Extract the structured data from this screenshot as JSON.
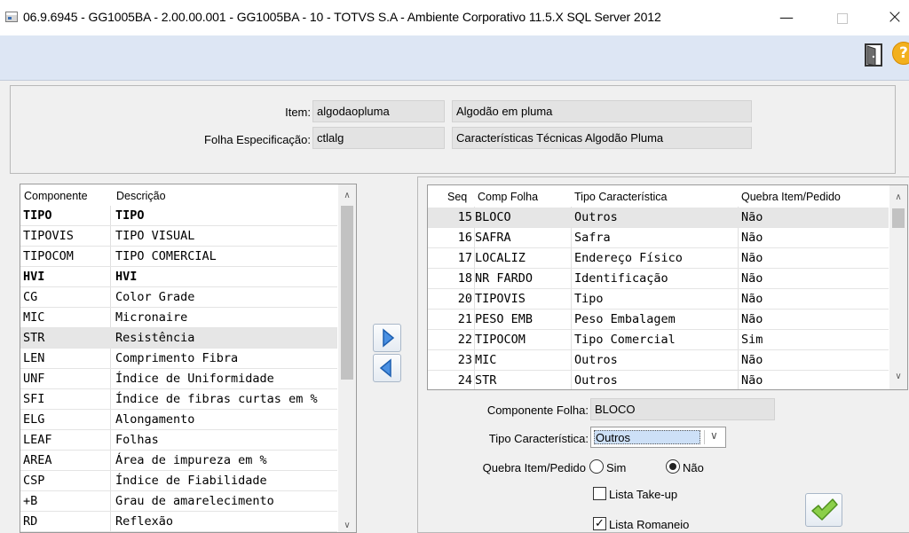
{
  "window": {
    "title": "06.9.6945 - GG1005BA - 2.00.00.001 - GG1005BA - 10 - TOTVS S.A - Ambiente Corporativo 11.5.X SQL Server 2012",
    "minimize": "—",
    "close": "×"
  },
  "header": {
    "item_label": "Item:",
    "item_code": "algodaopluma",
    "item_desc": "Algodão em pluma",
    "folha_label": "Folha Especificação:",
    "folha_code": "ctlalg",
    "folha_desc": "Características Técnicas Algodão Pluma"
  },
  "left_grid": {
    "col_componente": "Componente",
    "col_descricao": "Descrição",
    "rows": [
      {
        "c": "TIPO",
        "d": "TIPO"
      },
      {
        "c": "TIPOVIS",
        "d": "TIPO VISUAL"
      },
      {
        "c": "TIPOCOM",
        "d": "TIPO COMERCIAL"
      },
      {
        "c": "HVI",
        "d": "HVI"
      },
      {
        "c": "CG",
        "d": "Color Grade"
      },
      {
        "c": "MIC",
        "d": "Micronaire"
      },
      {
        "c": "STR",
        "d": "Resistência"
      },
      {
        "c": "LEN",
        "d": "Comprimento Fibra"
      },
      {
        "c": "UNF",
        "d": "Índice de Uniformidade"
      },
      {
        "c": "SFI",
        "d": "Índice de fibras curtas em %"
      },
      {
        "c": "ELG",
        "d": "Alongamento"
      },
      {
        "c": "LEAF",
        "d": "Folhas"
      },
      {
        "c": "AREA",
        "d": "Área de impureza em %"
      },
      {
        "c": "CSP",
        "d": "Índice de Fiabilidade"
      },
      {
        "c": "+B",
        "d": "Grau de amarelecimento"
      },
      {
        "c": "RD",
        "d": "Reflexão"
      }
    ]
  },
  "right_grid": {
    "col_seq": "Seq",
    "col_comp": "Comp Folha",
    "col_tipo": "Tipo Característica",
    "col_quebra": "Quebra Item/Pedido",
    "rows": [
      {
        "seq": "15",
        "comp": "BLOCO",
        "tipo": "Outros",
        "quebra": "Não"
      },
      {
        "seq": "16",
        "comp": "SAFRA",
        "tipo": "Safra",
        "quebra": "Não"
      },
      {
        "seq": "17",
        "comp": "LOCALIZ",
        "tipo": "Endereço Físico",
        "quebra": "Não"
      },
      {
        "seq": "18",
        "comp": "NR FARDO",
        "tipo": "Identificação",
        "quebra": "Não"
      },
      {
        "seq": "20",
        "comp": "TIPOVIS",
        "tipo": "Tipo",
        "quebra": "Não"
      },
      {
        "seq": "21",
        "comp": "PESO EMB",
        "tipo": "Peso Embalagem",
        "quebra": "Não"
      },
      {
        "seq": "22",
        "comp": "TIPOCOM",
        "tipo": "Tipo Comercial",
        "quebra": "Sim"
      },
      {
        "seq": "23",
        "comp": "MIC",
        "tipo": "Outros",
        "quebra": "Não"
      },
      {
        "seq": "24",
        "comp": "STR",
        "tipo": "Outros",
        "quebra": "Não"
      }
    ]
  },
  "form": {
    "componente_label": "Componente Folha:",
    "componente_value": "BLOCO",
    "tipo_label": "Tipo Característica:",
    "tipo_value": "Outros",
    "quebra_label": "Quebra Item/Pedido",
    "sim_label": "Sim",
    "nao_label": "Não",
    "take_up_label": "Lista Take-up",
    "romaneio_label": "Lista Romaneio",
    "check_mark": "✓"
  }
}
